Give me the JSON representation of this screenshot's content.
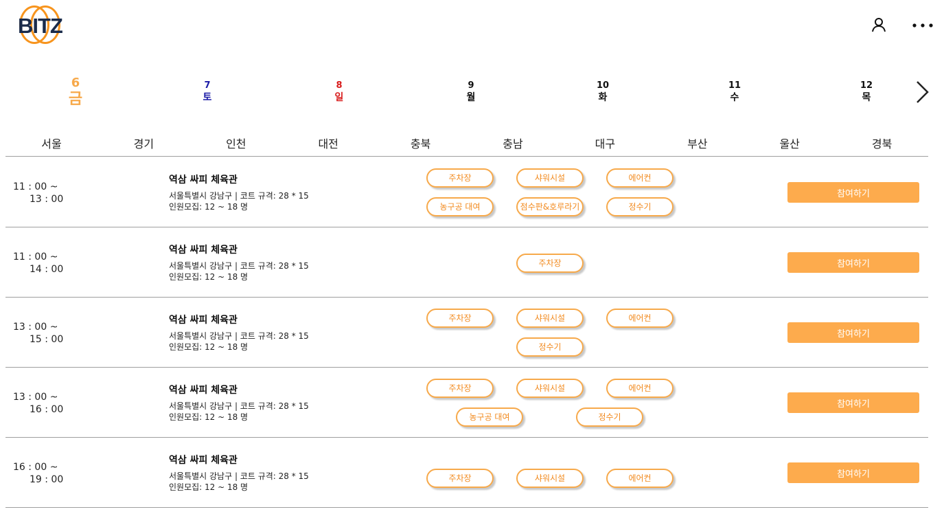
{
  "app": {
    "logo_text": "BITZ",
    "brand_color": "#f7941d",
    "accent_color": "#fdab4d",
    "icons": {
      "user": "user-icon",
      "more": "more-dots-icon",
      "next": "chevron-right-icon"
    }
  },
  "dates": [
    {
      "num": "6",
      "dow": "금",
      "color": "#f7a94a",
      "active": true
    },
    {
      "num": "7",
      "dow": "토",
      "color": "#1a1aa6"
    },
    {
      "num": "8",
      "dow": "일",
      "color": "#d81b1b"
    },
    {
      "num": "9",
      "dow": "월",
      "color": "#111111"
    },
    {
      "num": "10",
      "dow": "화",
      "color": "#111111"
    },
    {
      "num": "11",
      "dow": "수",
      "color": "#111111"
    },
    {
      "num": "12",
      "dow": "목",
      "color": "#111111"
    }
  ],
  "regions": [
    "서울",
    "경기",
    "인천",
    "대전",
    "충북",
    "충남",
    "대구",
    "부산",
    "울산",
    "경북"
  ],
  "matches": [
    {
      "start": "11 : 00 ~",
      "end": "13 : 00",
      "name": "역삼 싸피 체육관",
      "location": "서울특별시 강남구 | 코트 규격: 28 * 15",
      "recruit": "인원모집: 12 ~ 18 명",
      "amenities": [
        "주차장",
        "샤워시설",
        "에어컨",
        "농구공 대여",
        "점수판&호루라기",
        "정수기"
      ],
      "join_label": "참여하기"
    },
    {
      "start": "11 : 00 ~",
      "end": "14 : 00",
      "name": "역삼 싸피 체육관",
      "location": "서울특별시 강남구 | 코트 규격: 28 * 15",
      "recruit": "인원모집: 12 ~ 18 명",
      "amenities": [
        "주차장"
      ],
      "join_label": "참여하기"
    },
    {
      "start": "13 : 00 ~",
      "end": "15 : 00",
      "name": "역삼 싸피 체육관",
      "location": "서울특별시 강남구 | 코트 규격: 28 * 15",
      "recruit": "인원모집: 12 ~ 18 명",
      "amenities": [
        "주차장",
        "샤워시설",
        "에어컨",
        "정수기"
      ],
      "join_label": "참여하기"
    },
    {
      "start": "13 : 00 ~",
      "end": "16 : 00",
      "name": "역삼 싸피 체육관",
      "location": "서울특별시 강남구 | 코트 규격: 28 * 15",
      "recruit": "인원모집: 12 ~ 18 명",
      "amenities": [
        "주차장",
        "샤워시설",
        "에어컨",
        "농구공 대여",
        "정수기"
      ],
      "join_label": "참여하기"
    },
    {
      "start": "16 : 00 ~",
      "end": "19 : 00",
      "name": "역삼 싸피 체육관",
      "location": "서울특별시 강남구 | 코트 규격: 28 * 15",
      "recruit": "인원모집: 12 ~ 18 명",
      "amenities": [
        "주차장",
        "샤워시설",
        "에어컨"
      ],
      "join_label": "참여하기"
    }
  ]
}
